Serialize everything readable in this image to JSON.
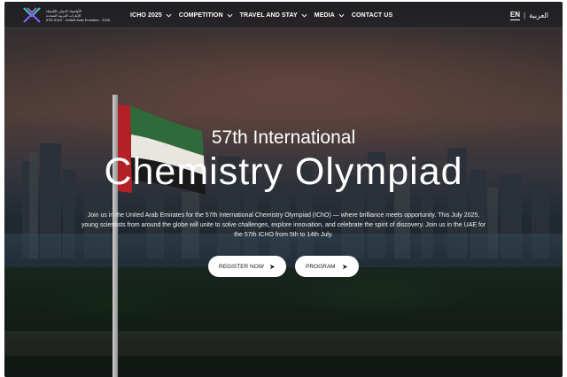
{
  "logo": {
    "line1": "الأولمبياد الدولي للكيمياء",
    "line2": "الإمارات العربية المتحدة",
    "line3": "57th IChO · United Arab Emirates · 2025"
  },
  "nav": {
    "items": [
      {
        "label": "ICHO 2025",
        "has_dropdown": true
      },
      {
        "label": "COMPETITION",
        "has_dropdown": true
      },
      {
        "label": "TRAVEL AND STAY",
        "has_dropdown": true
      },
      {
        "label": "MEDIA",
        "has_dropdown": true
      },
      {
        "label": "CONTACT US",
        "has_dropdown": false
      }
    ],
    "lang_en": "EN",
    "lang_sep": "|",
    "lang_ar": "العربية"
  },
  "hero": {
    "subtitle": "57th International",
    "title": "Chemistry Olympiad",
    "description": "Join us in the United Arab Emirates for the 57th International Chemistry Olympiad (IChO) — where brilliance meets opportunity. This July 2025, young scientists from around the globe will unite to solve challenges, explore innovation, and celebrate the spirit of discovery. Join us in the UAE for the 57th ICHO from 5th to 14th July.",
    "register_label": "REGISTER NOW",
    "program_label": "PROGRAM"
  },
  "colors": {
    "nav_bg": "#19191e",
    "button_bg": "#ffffff",
    "button_text": "#1a1a1a",
    "logo_teal": "#3fc1c9",
    "logo_purple": "#8b5cf6"
  },
  "icons": {
    "dropdown": "chevron-down-icon",
    "button_arrow": "arrow-right-icon"
  }
}
